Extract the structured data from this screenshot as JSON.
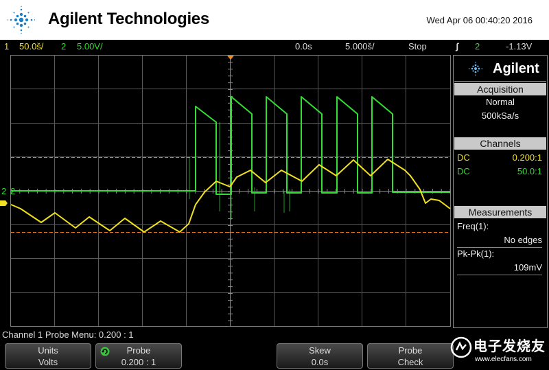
{
  "header": {
    "brand": "Agilent Technologies",
    "datetime": "Wed Apr 06 00:40:20 2016"
  },
  "status_bar": {
    "ch1_num": "1",
    "ch1_scale": "50.0š/",
    "ch2_num": "2",
    "ch2_scale": "5.00V/",
    "time_offset": "0.0s",
    "timebase": "5.000š/",
    "run_state": "Stop",
    "trigger_icon": "ʃ",
    "trigger_ch": "2",
    "trigger_level": "-1.13V"
  },
  "colors": {
    "ch1": "#f0e020",
    "ch2": "#33dd33",
    "grid": "#5a5a5a",
    "cursor": "#e07a30",
    "panel_title_bg": "#c9c9c9"
  },
  "side_panel": {
    "brand": "Agilent",
    "acquisition": {
      "title": "Acquisition",
      "mode": "Normal",
      "rate": "500kSa/s"
    },
    "channels": {
      "title": "Channels",
      "rows": [
        {
          "coupling": "DC",
          "ratio": "0.200:1",
          "color": "#f0e020"
        },
        {
          "coupling": "DC",
          "ratio": "50.0:1",
          "color": "#33dd33"
        }
      ]
    },
    "measurements": {
      "title": "Measurements",
      "items": [
        {
          "name": "Freq(1):",
          "value": "No edges"
        },
        {
          "name": "Pk-Pk(1):",
          "value": "109mV"
        }
      ]
    }
  },
  "ch2_marker_label": "2",
  "softkey_bar": {
    "menu_title": "Channel 1 Probe Menu: 0.200 : 1",
    "keys": [
      {
        "label": "Units",
        "value": "Volts"
      },
      {
        "label": "Probe",
        "value": "0.200 : 1"
      },
      {
        "label": "Skew",
        "value": "0.0s"
      },
      {
        "label": "Probe",
        "value": "Check"
      }
    ]
  },
  "watermark": {
    "cn": "电子发烧友",
    "url": "www.elecfans.com"
  }
}
